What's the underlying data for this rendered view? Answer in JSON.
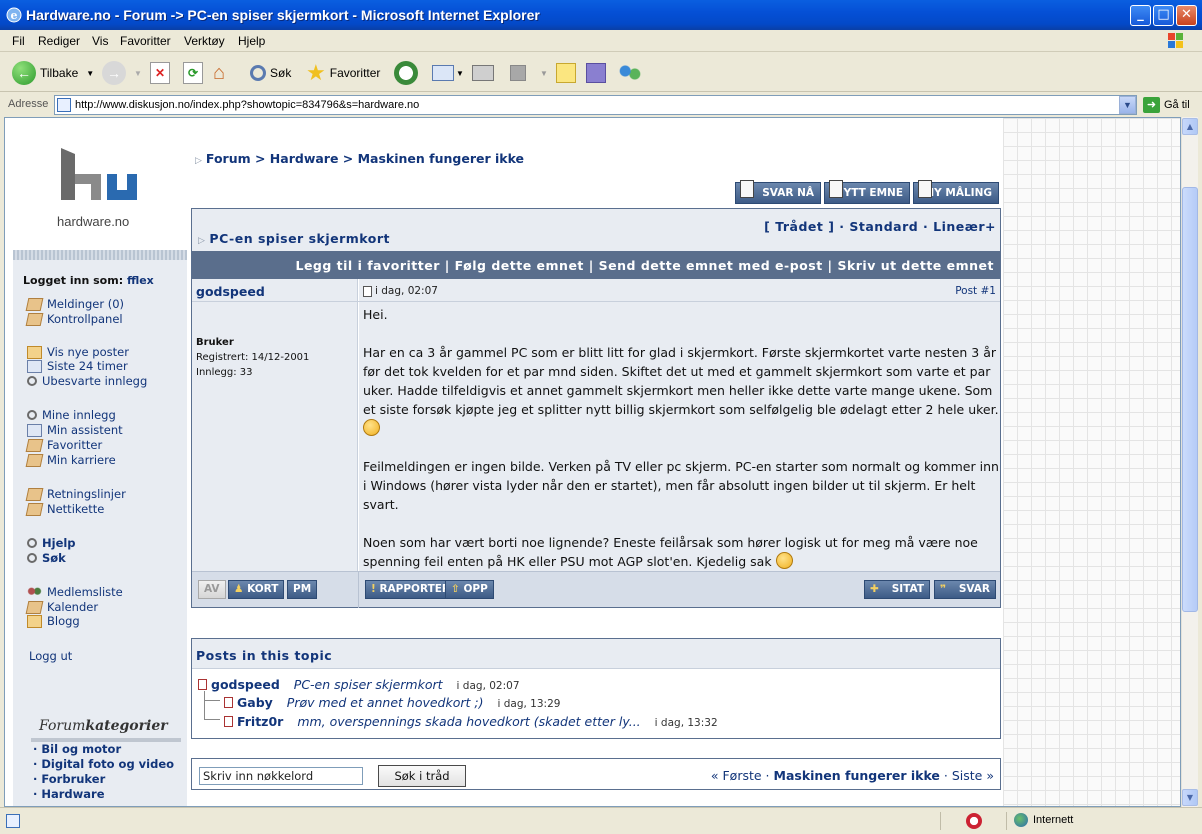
{
  "window": {
    "title": "Hardware.no - Forum -> PC-en spiser skjermkort - Microsoft Internet Explorer"
  },
  "menu": [
    "Fil",
    "Rediger",
    "Vis",
    "Favoritter",
    "Verktøy",
    "Hjelp"
  ],
  "toolbar": {
    "back": "Tilbake",
    "search": "Søk",
    "favorites": "Favoritter"
  },
  "address": {
    "label": "Adresse",
    "url": "http://www.diskusjon.no/index.php?showtopic=834796&s=hardware.no",
    "go": "Gå til"
  },
  "sidebar": {
    "logo_text": "hardware.no",
    "logged_in_label": "Logget inn som:",
    "username": "fflex",
    "links": {
      "messages": "Meldinger (0)",
      "control_panel": "Kontrollpanel",
      "new_posts": "Vis nye poster",
      "last24": "Siste 24 timer",
      "unanswered": "Ubesvarte innlegg",
      "my_posts": "Mine innlegg",
      "my_assistant": "Min assistent",
      "favorites": "Favoritter",
      "my_career": "Min karriere",
      "guidelines": "Retningslinjer",
      "netiquette": "Nettikette",
      "help": "Hjelp",
      "search": "Søk",
      "members": "Medlemsliste",
      "calendar": "Kalender",
      "blog": "Blogg",
      "logout": "Logg ut"
    },
    "categories_title_a": "Forum",
    "categories_title_b": "kategorier",
    "categories": [
      "· Bil og motor",
      "· Digital foto og video",
      "· Forbruker",
      "· Hardware"
    ]
  },
  "breadcrumb": "Forum > Hardware > Maskinen fungerer ikke",
  "top_buttons": {
    "reply": "SVAR NÅ",
    "new_topic": "NYTT EMNE",
    "new_poll": "NY MÅLING"
  },
  "topic": {
    "title": "PC-en spiser skjermkort",
    "view_modes": "[ Trådet ] · Standard · Lineær+",
    "actions": "Legg til i favoritter | Følg dette emnet | Send dette emnet med e-post | Skriv ut dette emnet"
  },
  "post": {
    "author": "godspeed",
    "date": "i dag, 02:07",
    "number": "Post #1",
    "role": "Bruker",
    "registered": "Registrert: 14/12-2001",
    "posts_count": "Innlegg: 33",
    "p1": "Hei.",
    "p2": "Har en ca 3 år gammel PC som er blitt litt for glad i skjermkort. Første skjermkortet varte nesten 3 år før det tok kvelden for et par mnd siden. Skiftet det ut med et gammelt skjermkort som varte et par uker. Hadde tilfeldigvis et annet gammelt skjermkort men heller ikke dette varte mange ukene. Som et siste forsøk kjøpte jeg et splitter nytt billig skjermkort som selfølgelig ble ødelagt etter 2 hele uker.",
    "p3": "Feilmeldingen er ingen bilde. Verken på TV eller pc skjerm. PC-en starter som normalt og kommer inn i Windows (hører vista lyder når den er startet), men får absolutt ingen bilder ut til skjerm. Er helt svart.",
    "p4": "Noen som har vært borti noe lignende? Eneste feilårsak som hører logisk ut for meg må være noe spenning feil enten på HK eller PSU mot AGP slot'en. Kjedelig sak"
  },
  "post_buttons": {
    "av": "AV",
    "short": "KORT",
    "pm": "PM",
    "report": "RAPPORTER",
    "up": "OPP",
    "quote": "SITAT",
    "reply": "SVAR"
  },
  "thread": {
    "heading": "Posts in this topic",
    "items": [
      {
        "author": "godspeed",
        "subject": "PC-en spiser skjermkort",
        "time": "i dag, 02:07"
      },
      {
        "author": "Gaby",
        "subject": "Prøv med et annet hovedkort ;)",
        "time": "i dag, 13:29"
      },
      {
        "author": "Fritz0r",
        "subject": "mm, overspennings skada hovedkort (skadet etter ly...",
        "time": "i dag, 13:32"
      }
    ]
  },
  "search": {
    "placeholder": "Skriv inn nøkkelord",
    "button": "Søk i tråd",
    "first": "« Første",
    "current": "Maskinen fungerer ikke",
    "last": "Siste »"
  },
  "status": {
    "zone": "Internett"
  }
}
